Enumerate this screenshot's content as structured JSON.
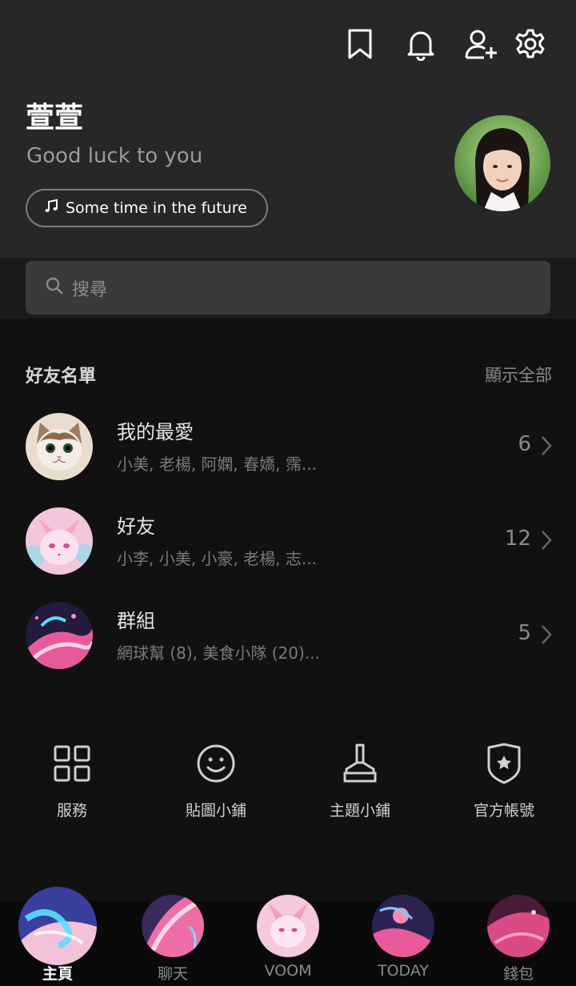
{
  "header": {
    "icons": [
      "bookmark-icon",
      "bell-icon",
      "add-friend-icon",
      "gear-icon"
    ],
    "profile_name": "萱萱",
    "status_message": "Good luck to you",
    "music_label": "Some time in the future"
  },
  "search": {
    "placeholder": "搜尋"
  },
  "friends_section": {
    "title": "好友名單",
    "show_all": "顯示全部",
    "rows": [
      {
        "title": "我的最愛",
        "subtitle": "小美, 老楊, 阿嫻, 春嬌, 霈...",
        "count": "6"
      },
      {
        "title": "好友",
        "subtitle": "小李, 小美, 小豪, 老楊, 志...",
        "count": "12"
      },
      {
        "title": "群組",
        "subtitle": "網球幫 (8), 美食小隊 (20)...",
        "count": "5"
      }
    ]
  },
  "services": [
    {
      "label": "服務",
      "icon": "grid-icon"
    },
    {
      "label": "貼圖小鋪",
      "icon": "smiley-icon"
    },
    {
      "label": "主題小鋪",
      "icon": "brush-icon"
    },
    {
      "label": "官方帳號",
      "icon": "shield-star-icon"
    }
  ],
  "bottom_nav": [
    {
      "label": "主頁",
      "active": true
    },
    {
      "label": "聊天",
      "active": false
    },
    {
      "label": "VOOM",
      "active": false
    },
    {
      "label": "TODAY",
      "active": false
    },
    {
      "label": "錢包",
      "active": false
    }
  ],
  "colors": {
    "header_bg": "#272727",
    "page_bg": "#111111",
    "search_bg": "#3a3a3a",
    "accent_pink": "#f06ea8"
  }
}
